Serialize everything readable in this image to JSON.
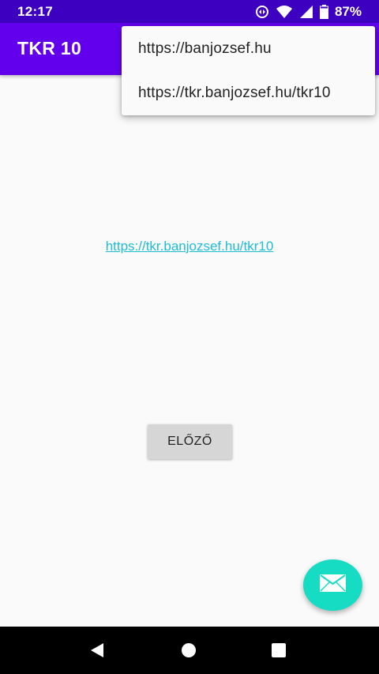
{
  "status_bar": {
    "time": "12:17",
    "battery": "87%",
    "icons": [
      "sync-icon",
      "wifi-icon",
      "signal-icon",
      "battery-icon"
    ]
  },
  "app_bar": {
    "title": "TKR 10",
    "background": "#6200ee"
  },
  "menu": {
    "items": [
      {
        "label": "https://banjozsef.hu"
      },
      {
        "label": "https://tkr.banjozsef.hu/tkr10"
      }
    ]
  },
  "content": {
    "link": "https://tkr.banjozsef.hu/tkr10",
    "link_color": "#1fbcd2",
    "prev_button": "ELŐZŐ"
  },
  "fab": {
    "icon": "mail-icon",
    "color": "#17dcc4"
  },
  "nav_bar": {
    "icons": [
      "back-icon",
      "home-icon",
      "recents-icon"
    ]
  }
}
